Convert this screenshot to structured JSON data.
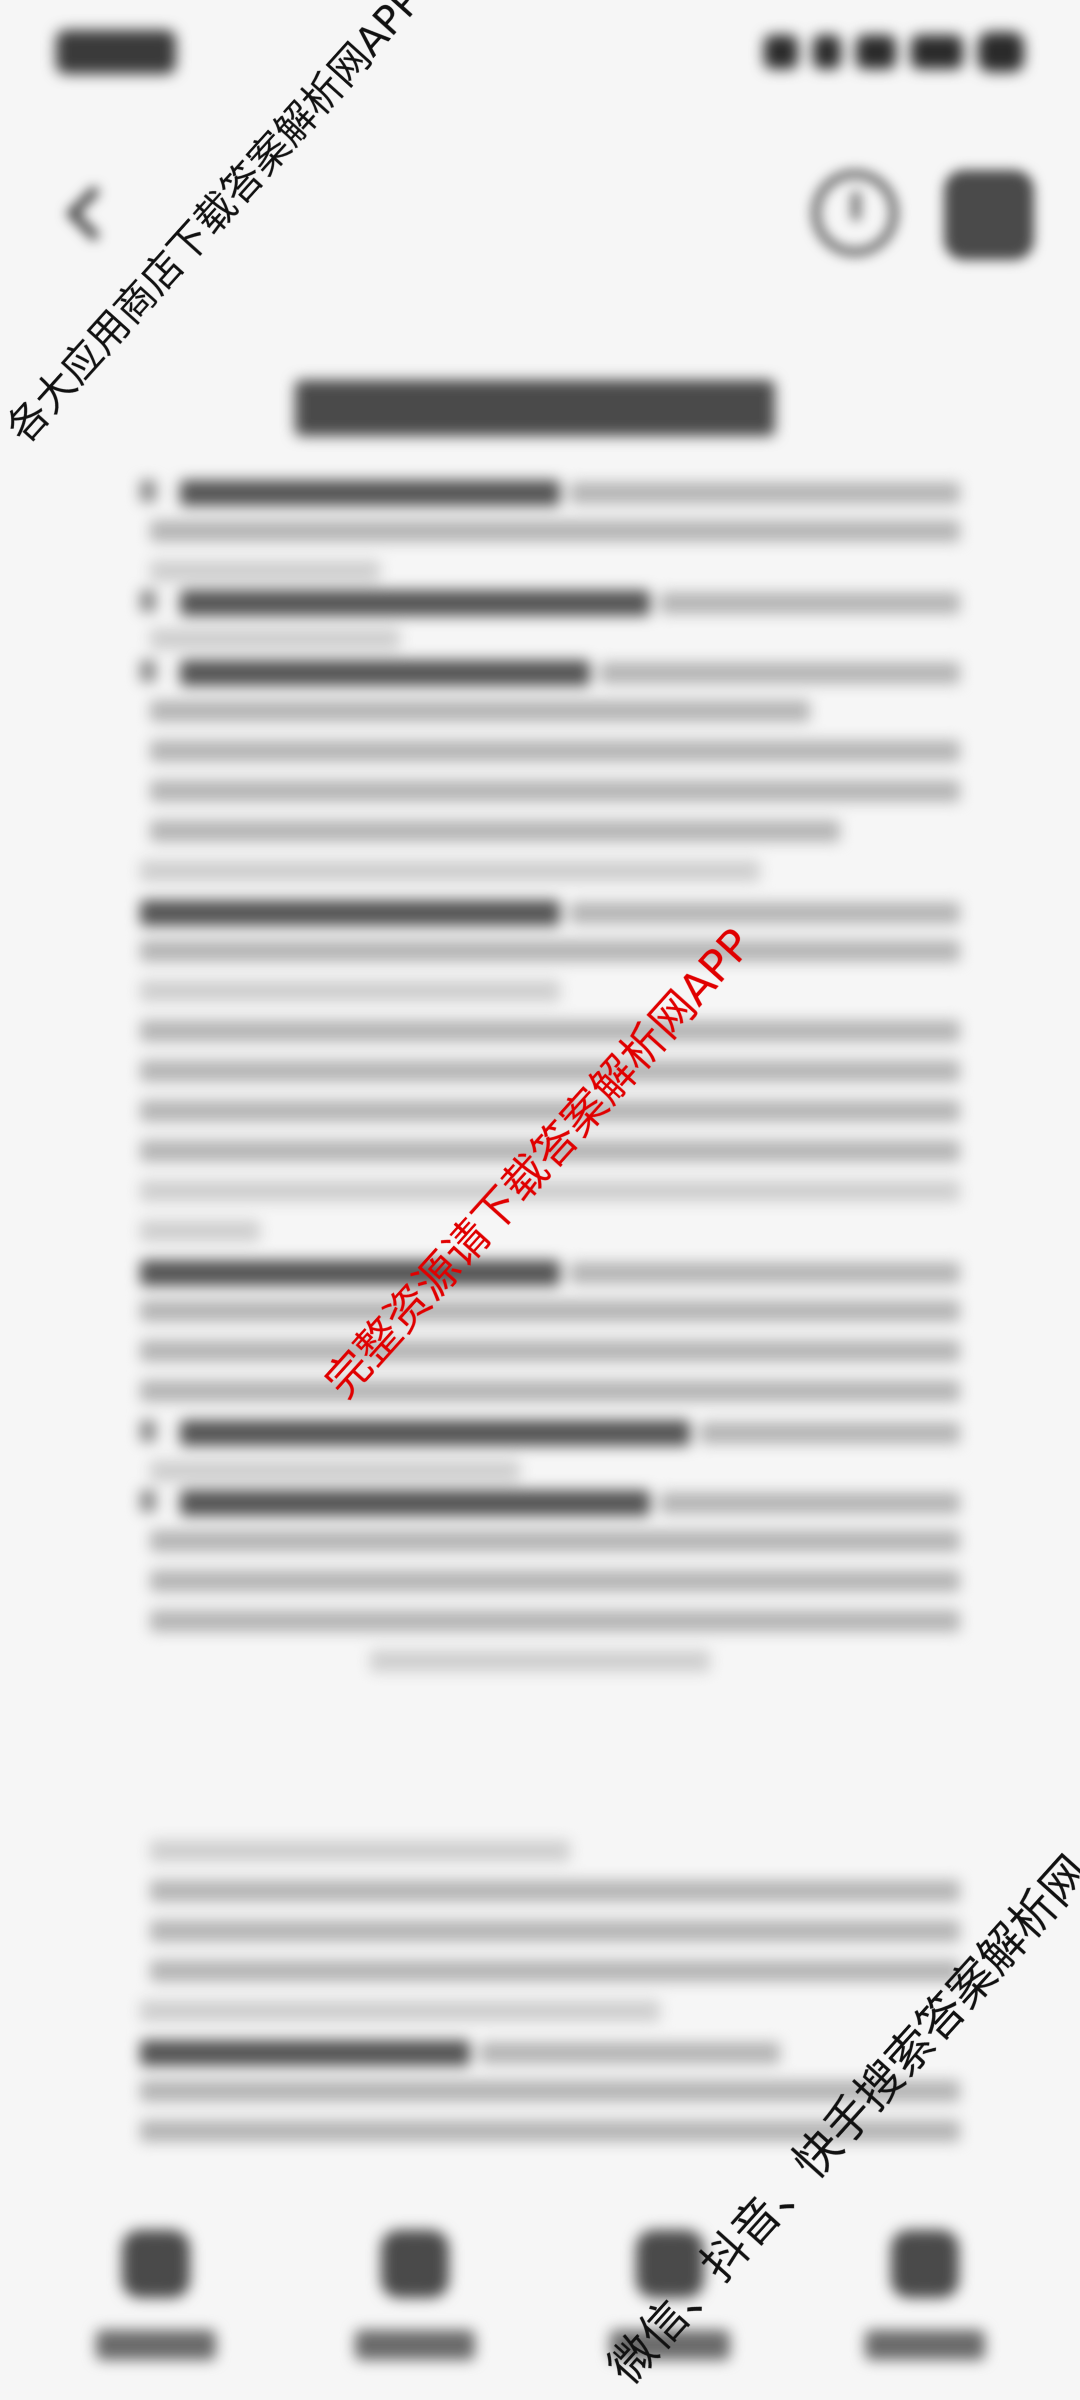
{
  "watermarks": {
    "top": "各大应用商店下载答案解析网APP",
    "center": "完整资源请下载答案解析网APP",
    "bottom": "微信、抖音、快手搜索答案解析网"
  },
  "icons": {
    "back": "back-arrow-icon",
    "history": "clock-icon",
    "grid": "grid-icon",
    "nav": [
      "home-icon",
      "grid-icon",
      "grid-icon",
      "grid-icon"
    ]
  },
  "colors": {
    "background": "#f6f6f6",
    "watermark_red": "#e00000",
    "watermark_black": "#111111"
  }
}
